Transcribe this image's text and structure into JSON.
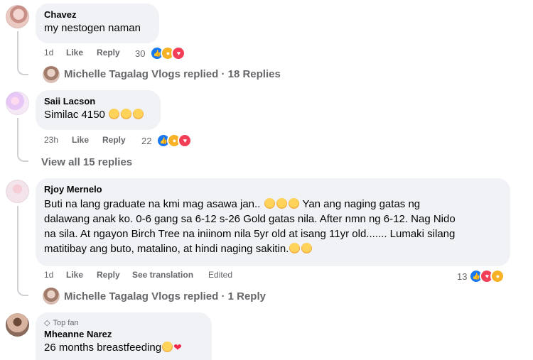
{
  "comments": [
    {
      "author": "Chavez",
      "text": "my nestogen naman",
      "time": "1d",
      "like": "Like",
      "reply": "Reply",
      "reaction_count": "30",
      "replies_by": "Michelle Tagalag Vlogs replied · 18 Replies"
    },
    {
      "author": "Saii Lacson",
      "text": "Similac 4150",
      "time": "23h",
      "like": "Like",
      "reply": "Reply",
      "reaction_count": "22",
      "view_replies": "View all 15 replies"
    },
    {
      "author": "Rjoy Mernelo",
      "text_lines": [
        "Buti na lang graduate na kmi mag asawa jan..",
        "Yan ang naging gatas ng",
        "dalawang anak ko. 0-6 gang sa 6-12 s-26 Gold gatas nila. After nmn ng 6-12. Nag Nido",
        "na sila. At ngayon Birch Tree na iniinom nila 5yr old at isang 11yr old....... Lumaki silang",
        "matitibay ang buto, matalino, at hindi naging sakitin."
      ],
      "time": "1d",
      "like": "Like",
      "reply": "Reply",
      "see_translation": "See translation",
      "edited": "Edited",
      "reaction_count": "13",
      "replies_by": "Michelle Tagalag Vlogs replied · 1 Reply"
    },
    {
      "badge": "Top fan",
      "author": "Mheanne Narez",
      "text": "26 months breastfeeding"
    }
  ],
  "colors": {
    "bubble": "#f0f2f5",
    "meta": "#65676b",
    "like_blue": "#1877f2",
    "love_red": "#f33e58",
    "haha_yellow": "#f7b125"
  }
}
